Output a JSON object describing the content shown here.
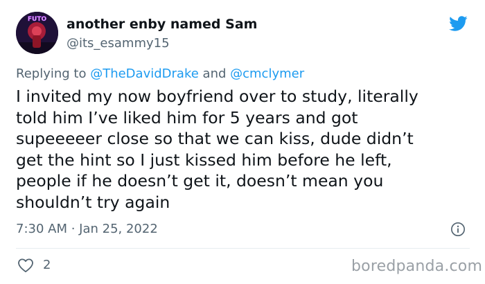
{
  "author": {
    "display_name": "another enby named Sam",
    "handle": "@its_esammy15",
    "avatar_text": "FUTO"
  },
  "reply": {
    "prefix": "Replying to ",
    "mention_1": "@TheDavidDrake",
    "conjunction": " and ",
    "mention_2": "@cmclymer"
  },
  "tweet": {
    "lines": [
      "I invited my now boyfriend over to study, literally",
      "told him I’ve liked him for 5 years and got",
      "supeeeeer close so that we can kiss, dude didn’t",
      "get the hint so I just kissed him before he left,",
      "people if he doesn’t get it, doesn’t mean you",
      "shouldn’t try again"
    ],
    "timestamp": "7:30 AM · Jan 25, 2022"
  },
  "actions": {
    "like_count": "2"
  },
  "watermark": "boredpanda.com",
  "icons": {
    "bird": "twitter-bird-icon",
    "info": "info-icon",
    "like": "heart-icon"
  },
  "colors": {
    "accent": "#1d9bf0",
    "secondary_text": "#536471",
    "primary_text": "#0f1419"
  }
}
